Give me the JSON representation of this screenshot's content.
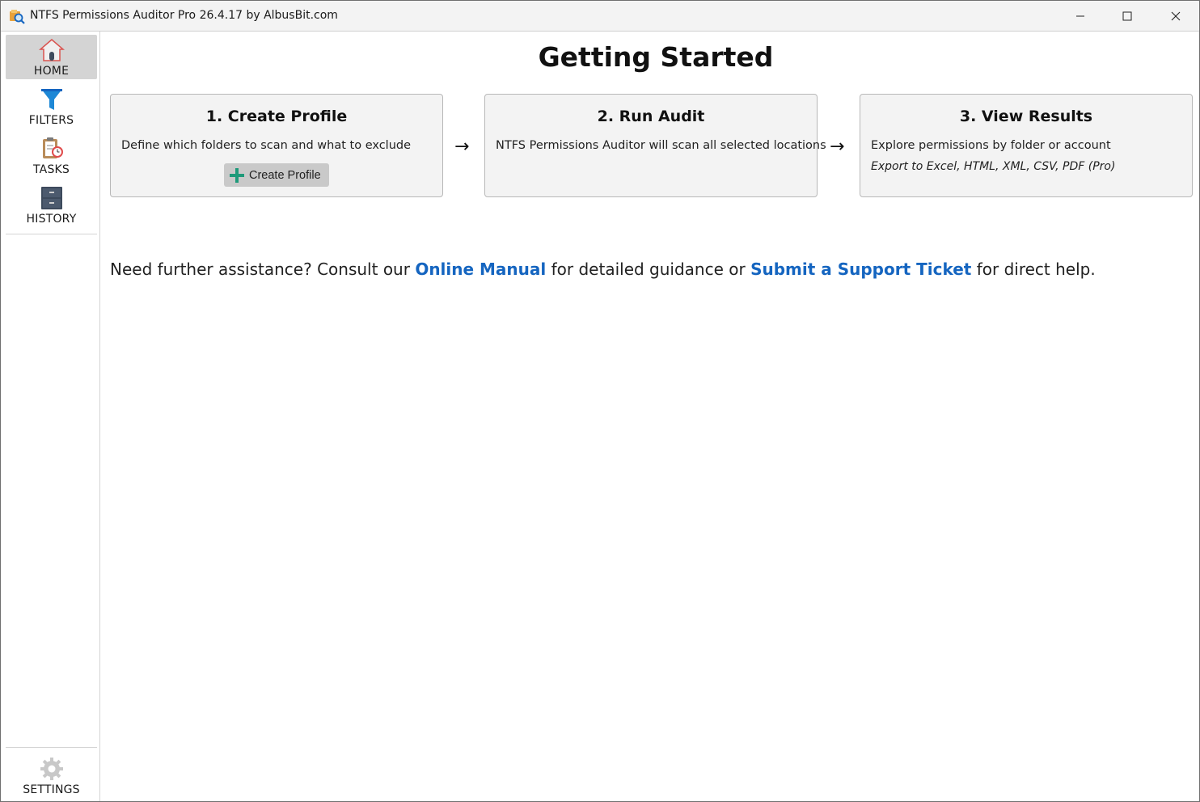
{
  "window": {
    "title": "NTFS Permissions Auditor Pro 26.4.17 by AlbusBit.com"
  },
  "sidebar": {
    "items": [
      {
        "label": "HOME",
        "icon": "home-icon",
        "active": true
      },
      {
        "label": "FILTERS",
        "icon": "filter-icon",
        "active": false
      },
      {
        "label": "TASKS",
        "icon": "tasks-icon",
        "active": false
      },
      {
        "label": "HISTORY",
        "icon": "history-icon",
        "active": false
      }
    ],
    "settings": {
      "label": "SETTINGS",
      "icon": "gear-icon"
    }
  },
  "main": {
    "title": "Getting Started",
    "steps": [
      {
        "title": "1. Create Profile",
        "desc": "Define which folders to scan and what to exclude",
        "button": "Create Profile"
      },
      {
        "title": "2. Run Audit",
        "desc": "NTFS Permissions Auditor will scan all selected locations"
      },
      {
        "title": "3. View Results",
        "desc": "Explore permissions by folder or account",
        "note": "Export to Excel, HTML, XML, CSV, PDF (Pro)"
      }
    ],
    "arrow": "→",
    "help": {
      "prefix": "Need further assistance? Consult our ",
      "manual_link": "Online Manual",
      "middle": " for detailed guidance or ",
      "ticket_link": "Submit a Support Ticket",
      "suffix": " for direct help."
    }
  },
  "colors": {
    "accent": "#1565c0",
    "active_nav": "#d4d4d4",
    "card_bg": "#f3f3f3",
    "plus_icon": "#1f9a7a"
  }
}
